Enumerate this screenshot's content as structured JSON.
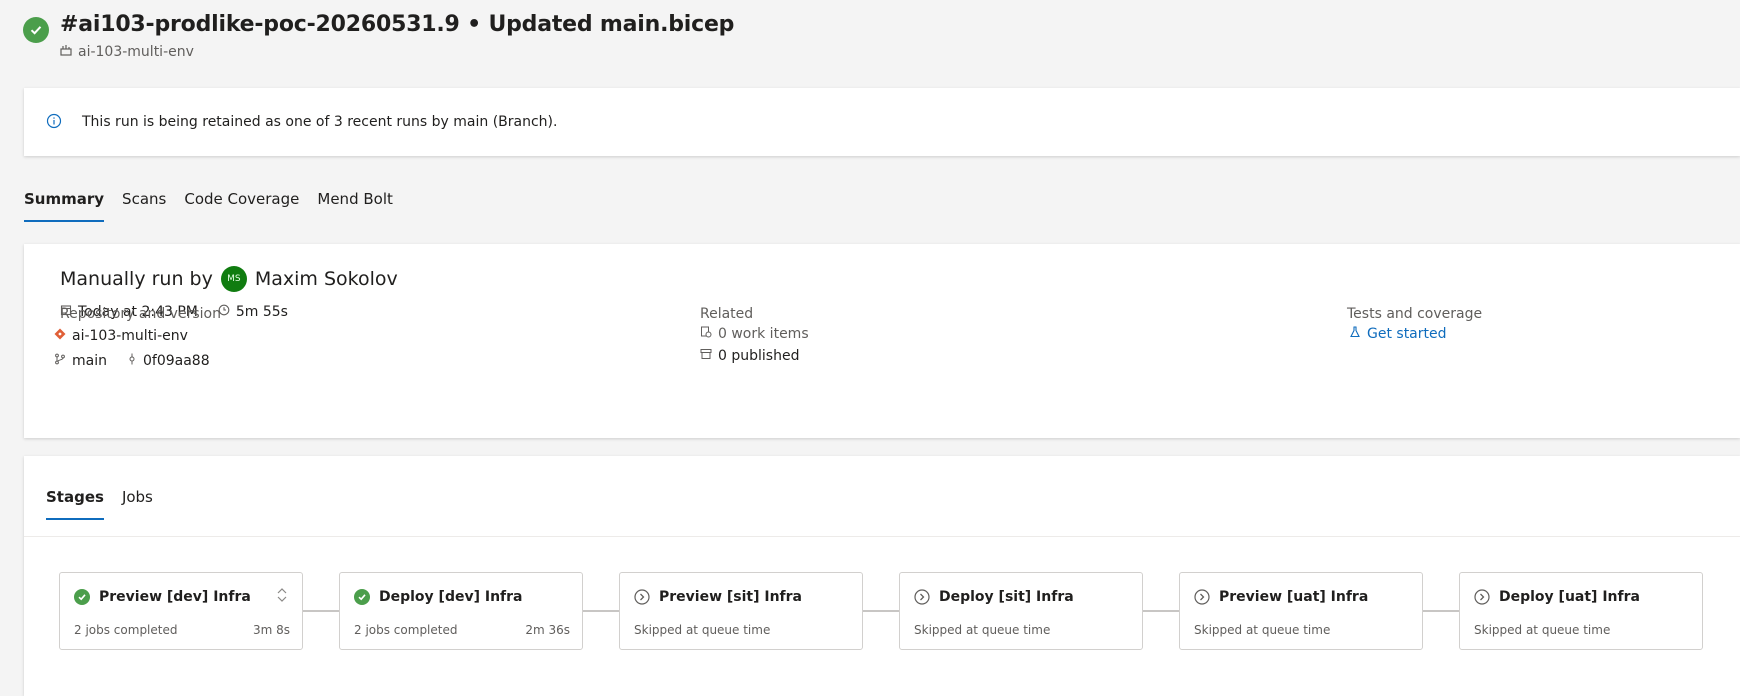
{
  "header": {
    "title": "#ai103-prodlike-poc-20260531.9 • Updated main.bicep",
    "pipeline_name": "ai-103-multi-env"
  },
  "banner": {
    "text": "This run is being retained as one of 3 recent runs by main (Branch)."
  },
  "tabs": [
    {
      "label": "Summary",
      "active": true
    },
    {
      "label": "Scans",
      "active": false
    },
    {
      "label": "Code Coverage",
      "active": false
    },
    {
      "label": "Mend Bolt",
      "active": false
    }
  ],
  "summary": {
    "run_by_prefix": "Manually run by",
    "user_initials": "MS",
    "user_name": "Maxim Sokolov",
    "started": "Today at 2:43 PM",
    "duration": "5m 55s",
    "repository": {
      "label": "Repository and version",
      "repo": "ai-103-multi-env",
      "branch": "main",
      "commit": "0f09aa88"
    },
    "related": {
      "label": "Related",
      "work_items": "0 work items",
      "published": "0 published"
    },
    "tests": {
      "label": "Tests and coverage",
      "link": "Get started"
    }
  },
  "stages_section": {
    "tabs": [
      {
        "label": "Stages",
        "active": true
      },
      {
        "label": "Jobs",
        "active": false
      }
    ],
    "stages": [
      {
        "name": "Preview [dev] Infra",
        "status": "succeeded",
        "detail": "2 jobs completed",
        "duration": "3m 8s"
      },
      {
        "name": "Deploy [dev] Infra",
        "status": "succeeded",
        "detail": "2 jobs completed",
        "duration": "2m 36s"
      },
      {
        "name": "Preview [sit] Infra",
        "status": "skipped",
        "detail": "Skipped at queue time",
        "duration": ""
      },
      {
        "name": "Deploy [sit] Infra",
        "status": "skipped",
        "detail": "Skipped at queue time",
        "duration": ""
      },
      {
        "name": "Preview [uat] Infra",
        "status": "skipped",
        "detail": "Skipped at queue time",
        "duration": ""
      },
      {
        "name": "Deploy [uat] Infra",
        "status": "skipped",
        "detail": "Skipped at queue time",
        "duration": ""
      }
    ]
  },
  "colors": {
    "success": "#4b9e4b",
    "link": "#0f6cbd",
    "avatar": "#107c10"
  }
}
